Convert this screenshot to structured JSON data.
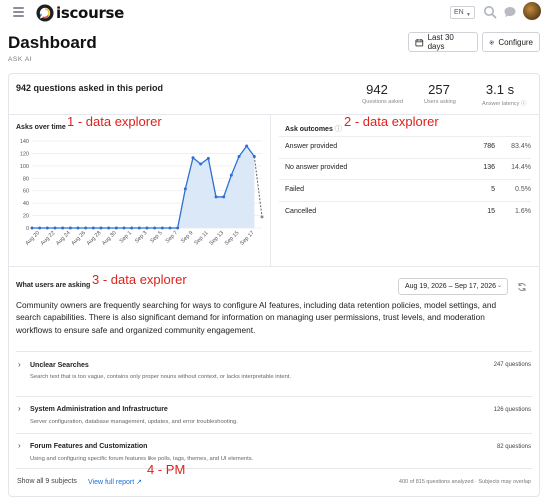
{
  "header": {
    "logo_text": "iscourse",
    "language": "EN",
    "icons": [
      "menu-icon",
      "search-icon",
      "chat-icon",
      "notification-icon"
    ]
  },
  "page": {
    "title": "Dashboard",
    "subtitle": "ASK AI",
    "date_button": "Last 30 days",
    "configure_button": "Configure"
  },
  "summary": {
    "headline": "942 questions asked in this period",
    "stats": [
      {
        "value": "942",
        "label": "Questions asked"
      },
      {
        "value": "257",
        "label": "Users asking"
      },
      {
        "value": "3.1 s",
        "label": "Answer latency"
      }
    ]
  },
  "annotations": {
    "a1": "1 - data explorer",
    "a2": "2 - data explorer",
    "a3": "3 - data explorer",
    "a4": "4 - PM"
  },
  "asks_over_time": {
    "title": "Asks over time"
  },
  "ask_outcomes": {
    "title": "Ask outcomes",
    "rows": [
      {
        "label": "Answer provided",
        "count": "786",
        "pct": "83.4%"
      },
      {
        "label": "No answer provided",
        "count": "136",
        "pct": "14.4%"
      },
      {
        "label": "Failed",
        "count": "5",
        "pct": "0.5%"
      },
      {
        "label": "Cancelled",
        "count": "15",
        "pct": "1.6%"
      }
    ]
  },
  "users_asking": {
    "title": "What users are asking",
    "date_range": "Aug 19, 2026 – Sep 17, 2026",
    "paragraph": "Community owners are frequently searching for ways to configure AI features, including data retention policies, model settings, and search capabilities. There is also significant demand for information on managing user permissions, trust levels, and moderation workflows to ensure safe and organized community engagement.",
    "topics": [
      {
        "title": "Unclear Searches",
        "desc": "Search text that is too vague, contains only proper nouns without context, or lacks interpretable intent.",
        "count": "247 questions"
      },
      {
        "title": "System Administration and Infrastructure",
        "desc": "Server configuration, database management, updates, and error troubleshooting.",
        "count": "126 questions"
      },
      {
        "title": "Forum Features and Customization",
        "desc": "Using and configuring specific forum features like polls, tags, themes, and UI elements.",
        "count": "82 questions"
      }
    ],
    "show_all": "Show all 9 subjects",
    "view_report": "View full report",
    "analyzed": "400 of 815 questions analyzed · Subjects may overlap"
  },
  "chart_data": {
    "type": "area",
    "title": "Asks over time",
    "x": [
      "Aug 19",
      "Aug 20",
      "Aug 21",
      "Aug 22",
      "Aug 23",
      "Aug 24",
      "Aug 25",
      "Aug 26",
      "Aug 27",
      "Aug 28",
      "Aug 29",
      "Aug 30",
      "Aug 31",
      "Sep 1",
      "Sep 2",
      "Sep 3",
      "Sep 4",
      "Sep 5",
      "Sep 6",
      "Sep 7",
      "Sep 8",
      "Sep 9",
      "Sep 10",
      "Sep 11",
      "Sep 12",
      "Sep 13",
      "Sep 14",
      "Sep 15",
      "Sep 16",
      "Sep 17",
      "Sep 18"
    ],
    "values": [
      0,
      0,
      0,
      0,
      0,
      0,
      0,
      0,
      0,
      0,
      0,
      0,
      0,
      0,
      0,
      0,
      0,
      0,
      0,
      0,
      63,
      113,
      103,
      112,
      50,
      50,
      85,
      115,
      132,
      115,
      18
    ],
    "partial_last": true,
    "tick_labels": [
      "Aug 20",
      "Aug 22",
      "Aug 24",
      "Aug 26",
      "Aug 28",
      "Aug 30",
      "Sep 1",
      "Sep 3",
      "Sep 5",
      "Sep 7",
      "Sep 9",
      "Sep 11",
      "Sep 13",
      "Sep 15",
      "Sep 17"
    ],
    "yticks": [
      0,
      20,
      40,
      60,
      80,
      100,
      120,
      140
    ],
    "ylim": [
      0,
      140
    ],
    "grid": true,
    "color": "#2f6fd1",
    "fill": "#dbe8f7"
  }
}
